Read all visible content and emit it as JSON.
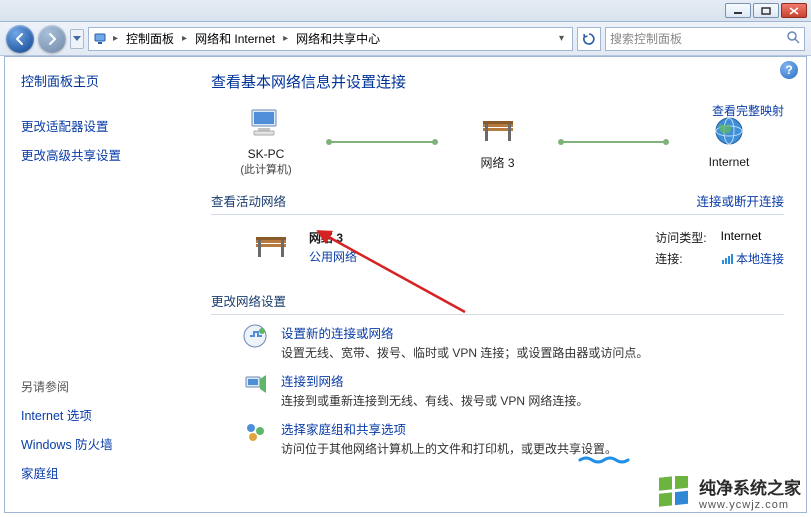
{
  "window": {
    "minimize_tip": "最小化",
    "maximize_tip": "最大化",
    "close_tip": "关闭"
  },
  "breadcrumb": {
    "segments": [
      "控制面板",
      "网络和 Internet",
      "网络和共享中心"
    ]
  },
  "search": {
    "placeholder": "搜索控制面板"
  },
  "sidebar": {
    "heading": "控制面板主页",
    "link_adapter": "更改适配器设置",
    "link_advanced": "更改高级共享设置",
    "see_also": "另请参阅",
    "see_also_items": [
      "Internet 选项",
      "Windows 防火墙",
      "家庭组"
    ]
  },
  "main": {
    "title": "查看基本网络信息并设置连接",
    "map": {
      "pc_name": "SK-PC",
      "pc_sub": "(此计算机)",
      "net_name": "网络  3",
      "internet": "Internet",
      "full_map_link": "查看完整映射"
    },
    "section_active": {
      "header": "查看活动网络",
      "right_link": "连接或断开连接",
      "network_name": "网络  3",
      "network_type": "公用网络",
      "access_label": "访问类型:",
      "access_value": "Internet",
      "conn_label": "连接:",
      "conn_value": "本地连接"
    },
    "section_change": {
      "header": "更改网络设置"
    },
    "tasks": [
      {
        "title": "设置新的连接或网络",
        "desc": "设置无线、宽带、拨号、临时或 VPN 连接；或设置路由器或访问点。"
      },
      {
        "title": "连接到网络",
        "desc": "连接到或重新连接到无线、有线、拨号或 VPN 网络连接。"
      },
      {
        "title": "选择家庭组和共享选项",
        "desc": "访问位于其他网络计算机上的文件和打印机，或更改共享设置。"
      }
    ]
  },
  "watermark": {
    "title": "纯净系统之家",
    "url": "www.ycwjz.com"
  }
}
